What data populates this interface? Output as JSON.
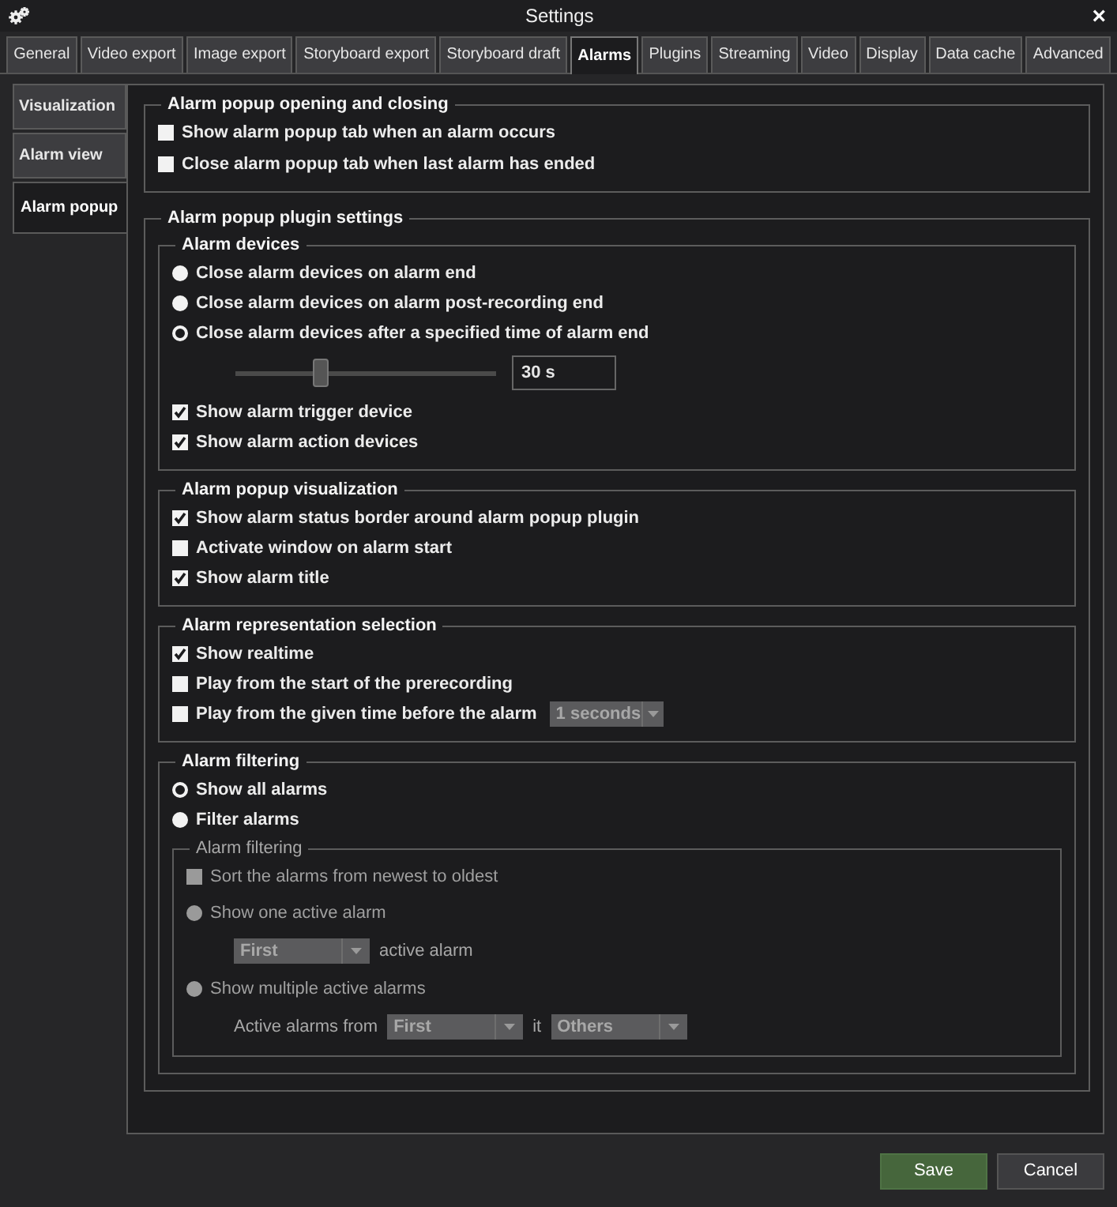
{
  "window": {
    "title": "Settings",
    "close": "×"
  },
  "tabs": [
    {
      "label": "General",
      "selected": false
    },
    {
      "label": "Video export",
      "selected": false
    },
    {
      "label": "Image export",
      "selected": false
    },
    {
      "label": "Storyboard export",
      "selected": false
    },
    {
      "label": "Storyboard draft",
      "selected": false
    },
    {
      "label": "Alarms",
      "selected": true
    },
    {
      "label": "Plugins",
      "selected": false
    },
    {
      "label": "Streaming",
      "selected": false
    },
    {
      "label": "Video",
      "selected": false
    },
    {
      "label": "Display",
      "selected": false
    },
    {
      "label": "Data cache",
      "selected": false
    },
    {
      "label": "Advanced",
      "selected": false
    }
  ],
  "sidebar": {
    "items": [
      {
        "label": "Visualization",
        "selected": false
      },
      {
        "label": "Alarm view",
        "selected": false
      },
      {
        "label": "Alarm popup",
        "selected": true
      }
    ]
  },
  "panel": {
    "sections": [
      {
        "kind": "group",
        "title": "Alarm popup opening and closing",
        "items": [
          {
            "kind": "checkbox",
            "label": "Show alarm popup tab when an alarm occurs",
            "checked": false
          },
          {
            "kind": "checkbox",
            "label": "Close alarm popup tab when last alarm has ended",
            "checked": false
          }
        ]
      },
      {
        "kind": "group",
        "title": "Alarm popup plugin settings",
        "items": [
          {
            "kind": "group",
            "title": "Alarm devices",
            "items": [
              {
                "kind": "radio",
                "label": "Close alarm devices on alarm end",
                "selected": false
              },
              {
                "kind": "radio",
                "label": "Close alarm devices on alarm post-recording end",
                "selected": false
              },
              {
                "kind": "radio",
                "label": "Close alarm devices after a specified time of alarm end",
                "selected": true
              },
              {
                "kind": "slider",
                "level": 0.33,
                "value": "30 s"
              },
              {
                "kind": "checkbox",
                "label": "Show alarm trigger device",
                "checked": true
              },
              {
                "kind": "checkbox",
                "label": "Show alarm action devices",
                "checked": true
              }
            ]
          },
          {
            "kind": "group",
            "title": "Alarm popup visualization",
            "items": [
              {
                "kind": "checkbox",
                "label": "Show alarm status border around alarm popup plugin",
                "checked": true
              },
              {
                "kind": "checkbox",
                "label": "Activate window on alarm start",
                "checked": false
              },
              {
                "kind": "checkbox",
                "label": "Show alarm title",
                "checked": true
              }
            ]
          },
          {
            "kind": "group",
            "title": "Alarm representation selection",
            "items": [
              {
                "kind": "checkbox",
                "label": "Show realtime",
                "checked": true
              },
              {
                "kind": "checkbox",
                "label": "Play from the start of the prerecording",
                "checked": false
              },
              {
                "kind": "checkbox",
                "label": "Play from the given time before the alarm",
                "checked": false,
                "dropdown": {
                  "value": "1 seconds",
                  "disabled": true
                }
              }
            ]
          },
          {
            "kind": "group",
            "title": "Alarm filtering",
            "items": [
              {
                "kind": "radio",
                "label": "Show all alarms",
                "selected": true
              },
              {
                "kind": "radio",
                "label": "Filter alarms",
                "selected": false
              },
              {
                "kind": "group",
                "title": "Alarm filtering",
                "disabled": true,
                "items": [
                  {
                    "kind": "checkbox",
                    "label": "Sort the alarms from newest to oldest",
                    "checked": false
                  },
                  {
                    "kind": "radio",
                    "label": "Show one active alarm",
                    "selected": false
                  },
                  {
                    "kind": "row",
                    "parts": [
                      {
                        "kind": "dropdown",
                        "value": "First"
                      },
                      {
                        "kind": "text",
                        "text": "active alarm"
                      }
                    ]
                  },
                  {
                    "kind": "radio",
                    "label": "Show multiple active alarms",
                    "selected": false
                  },
                  {
                    "kind": "row",
                    "parts": [
                      {
                        "kind": "text",
                        "text": "Active alarms from"
                      },
                      {
                        "kind": "dropdown",
                        "value": "First"
                      },
                      {
                        "kind": "text",
                        "text": "it"
                      },
                      {
                        "kind": "dropdown",
                        "value": "Others"
                      }
                    ]
                  }
                ]
              }
            ]
          }
        ]
      }
    ]
  },
  "buttons": [
    {
      "label": "Save",
      "kind": "primary"
    },
    {
      "label": "Cancel",
      "kind": "secondary"
    }
  ]
}
